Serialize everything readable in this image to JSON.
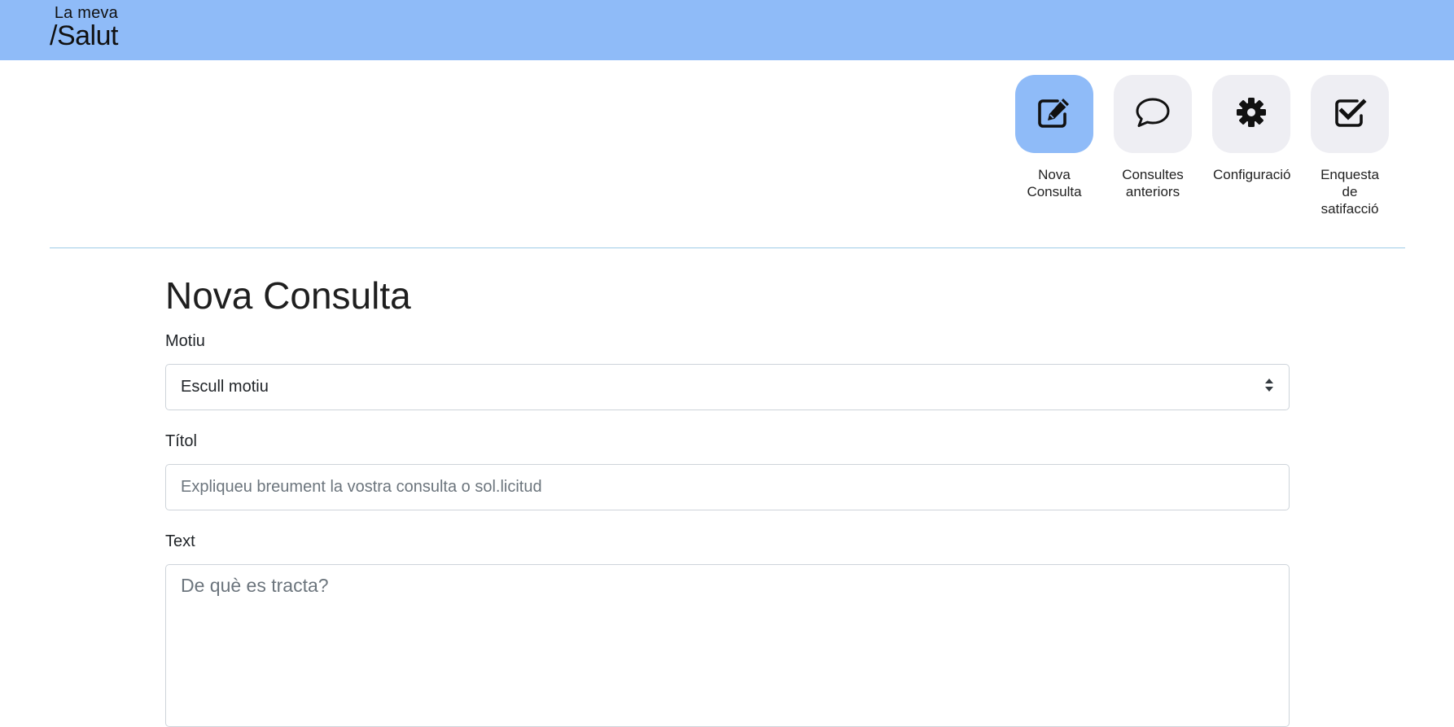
{
  "header": {
    "logo_small": "La meva",
    "logo_big": "/Salut",
    "background_color": "#8fbbf8"
  },
  "nav": {
    "items": [
      {
        "label": "Nova Consulta",
        "icon": "edit-icon",
        "active": true
      },
      {
        "label": "Consultes anteriors",
        "icon": "speech-bubble-icon",
        "active": false
      },
      {
        "label": "Configuració",
        "icon": "gear-icon",
        "active": false
      },
      {
        "label": "Enquesta de satifacció",
        "icon": "checkbox-icon",
        "active": false
      }
    ]
  },
  "form": {
    "title": "Nova Consulta",
    "motiu_label": "Motiu",
    "motiu_value": "Escull motiu",
    "titol_label": "Títol",
    "titol_placeholder": "Expliqueu breument la vostra consulta o sol.licitud",
    "text_label": "Text",
    "text_placeholder": "De què es tracta?"
  },
  "colors": {
    "accent": "#8fbbf8",
    "tile_inactive": "#eeeef3",
    "divider": "#9fcbe8"
  }
}
